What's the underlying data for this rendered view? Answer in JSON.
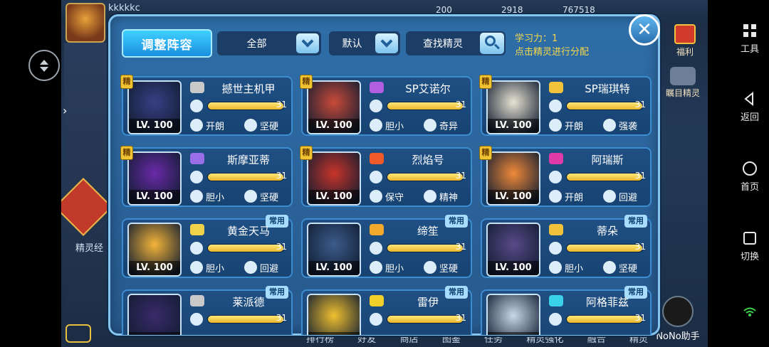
{
  "player": {
    "name": "kkkkkc"
  },
  "resources": [
    {
      "value": "200"
    },
    {
      "value": "2918"
    },
    {
      "value": "767518"
    }
  ],
  "side_labels": {
    "fuli": "福利",
    "mumu": "瞩目精灵",
    "spirit_exp": "精灵经",
    "nono": "NoNo助手"
  },
  "bottom_tabs": [
    "排行榜",
    "好友",
    "商店",
    "图鉴",
    "任务",
    "精灵强化",
    "融合",
    "精灵"
  ],
  "android_nav": [
    {
      "label": "工具",
      "icon": "grid-icon"
    },
    {
      "label": "返回",
      "icon": "back-icon"
    },
    {
      "label": "首页",
      "icon": "home-icon"
    },
    {
      "label": "切换",
      "icon": "recents-icon"
    }
  ],
  "panel": {
    "adjust_label": "调整阵容",
    "filter_label": "全部",
    "sort_label": "默认",
    "search_label": "查找精灵",
    "learn_label": "学习力：1",
    "learn_hint": "点击精灵进行分配",
    "close_label": "✕"
  },
  "colors": {
    "accent": "#f5d94a",
    "panel": "#2f6ea8",
    "bar": "#e9b62a"
  },
  "cards": [
    {
      "name": "撼世主机甲",
      "level": "LV. 100",
      "stat": "31",
      "stat_fill": 1.0,
      "nature1": "开朗",
      "nature2": "坚硬",
      "badge": "精",
      "type_color": "#c9c9c9",
      "portrait_color": "#3a3f86"
    },
    {
      "name": "SP艾诺尔",
      "level": "LV. 100",
      "stat": "31",
      "stat_fill": 1.0,
      "nature1": "胆小",
      "nature2": "奇异",
      "badge": "精",
      "type_color": "#b25ee0",
      "portrait_color": "#c94a3a"
    },
    {
      "name": "SP瑞琪特",
      "level": "LV. 100",
      "stat": "31",
      "stat_fill": 1.0,
      "nature1": "开朗",
      "nature2": "强袭",
      "badge": "精",
      "type_color": "#f2c23a",
      "portrait_color": "#e8e3d2"
    },
    {
      "name": "斯摩亚蒂",
      "level": "LV. 100",
      "stat": "31",
      "stat_fill": 1.0,
      "nature1": "胆小",
      "nature2": "坚硬",
      "badge": "精",
      "type_color": "#9a6ee8",
      "portrait_color": "#6a2aa8"
    },
    {
      "name": "烈焰号",
      "level": "LV. 100",
      "stat": "31",
      "stat_fill": 1.0,
      "nature1": "保守",
      "nature2": "精神",
      "badge": "精",
      "type_color": "#f05a2a",
      "portrait_color": "#c8342a"
    },
    {
      "name": "阿瑞斯",
      "level": "LV. 100",
      "stat": "31",
      "stat_fill": 1.0,
      "nature1": "开朗",
      "nature2": "回避",
      "badge": "精",
      "type_color": "#e03aa8",
      "portrait_color": "#f08a3a"
    },
    {
      "name": "黄金天马",
      "level": "LV. 100",
      "stat": "31",
      "stat_fill": 1.0,
      "nature1": "胆小",
      "nature2": "回避",
      "badge": "常用",
      "type_color": "#f2d24a",
      "portrait_color": "#f4b43a"
    },
    {
      "name": "缔笙",
      "level": "LV. 100",
      "stat": "31",
      "stat_fill": 1.0,
      "nature1": "胆小",
      "nature2": "坚硬",
      "badge": "常用",
      "type_color": "#f2a82a",
      "portrait_color": "#3c5c8c"
    },
    {
      "name": "蒂朵",
      "level": "LV. 100",
      "stat": "31",
      "stat_fill": 1.0,
      "nature1": "胆小",
      "nature2": "坚硬",
      "badge": "常用",
      "type_color": "#f2c23a",
      "portrait_color": "#5a4a8a"
    },
    {
      "name": "莱派德",
      "level": "",
      "stat": "31",
      "stat_fill": 1.0,
      "nature1": "",
      "nature2": "",
      "badge": "常用",
      "type_color": "#c9c9c9",
      "portrait_color": "#3a2a6a"
    },
    {
      "name": "雷伊",
      "level": "",
      "stat": "31",
      "stat_fill": 1.0,
      "nature1": "",
      "nature2": "",
      "badge": "常用",
      "type_color": "#f2d02a",
      "portrait_color": "#f0c030"
    },
    {
      "name": "阿格菲兹",
      "level": "",
      "stat": "31",
      "stat_fill": 1.0,
      "nature1": "",
      "nature2": "",
      "badge": "常用",
      "type_color": "#3ad2e8",
      "portrait_color": "#c8d8e8"
    }
  ]
}
